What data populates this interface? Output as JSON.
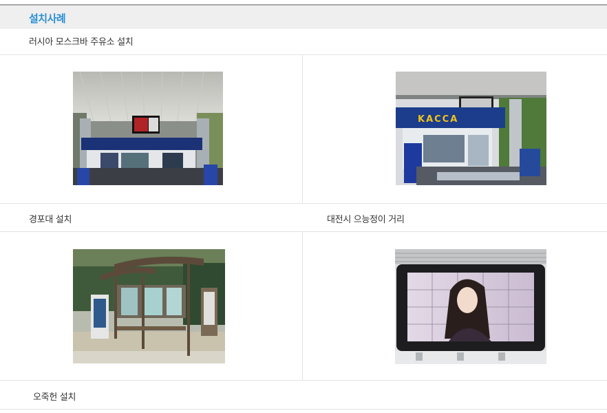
{
  "section": {
    "title": "설치사례"
  },
  "cases": [
    {
      "caption": "러시아 모스크바 주유소 설치"
    },
    {
      "caption": "경포대 설치"
    },
    {
      "caption": "대전시 으능정이 거리"
    },
    {
      "caption": "오죽헌 설치"
    }
  ],
  "photos": {
    "gas_station_2_sign": "KACCA"
  }
}
